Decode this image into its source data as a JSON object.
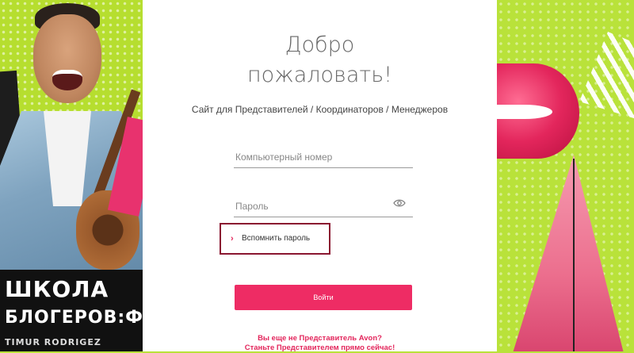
{
  "left_poster": {
    "title_line1": "ШКОЛА",
    "title_line2": "БЛОГЕРОВ:ФО",
    "title_line3": "TIMUR RODRIGEZ"
  },
  "login": {
    "welcome_line1": "Добро",
    "welcome_line2": "пожаловать!",
    "subtitle": "Сайт для Представителей / Координаторов / Менеджеров",
    "computer_number_placeholder": "Компьютерный номер",
    "password_placeholder": "Пароль",
    "forgot_password": "Вспомнить пароль",
    "submit_label": "Войти",
    "join_line1": "Вы еще не Представитель Avon?",
    "join_line2": "Станьте Представителем прямо сейчас!"
  },
  "colors": {
    "accent": "#ee2c64",
    "background": "#b9e23a",
    "highlight_border": "#8a1630"
  },
  "icons": {
    "password_toggle": "eye-icon",
    "forgot_chevron": "chevron-right-icon"
  }
}
